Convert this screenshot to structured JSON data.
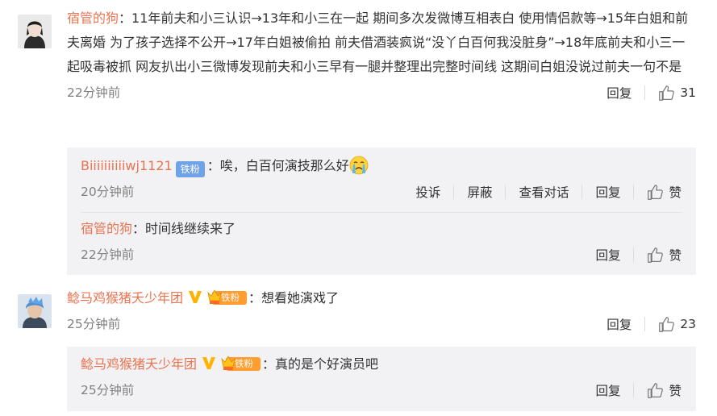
{
  "comments": [
    {
      "username": "宿管的狗",
      "text": "11年前夫和小三认识→13年和小三在一起 期间多次发微博互相表白 使用情侣款等→15年白姐和前夫离婚 为了孩子选择不公开→17年白姐被偷拍 前夫借酒装疯说“没丫白百何我没脏身”→18年底前夫和小三一起吸毒被抓 网友扒出小三微博发现前夫和小三早有一腿并整理出完整时间线 这期间白姐没说过前夫一句不是",
      "time": "22分钟前",
      "reply_label": "回复",
      "likes": "31",
      "replies": [
        {
          "username": "Biiiiiiiiiiwj1121",
          "badge": "铁粉",
          "text": "唉，白百何演技那么好",
          "emoji": "crying-face",
          "time": "20分钟前",
          "report_label": "投诉",
          "block_label": "屏蔽",
          "view_conv_label": "查看对话",
          "reply_label": "回复",
          "like_label": "赞"
        },
        {
          "username": "宿管的狗",
          "text": "时间线继续来了",
          "time": "22分钟前",
          "reply_label": "回复",
          "like_label": "赞"
        }
      ]
    },
    {
      "username": "鲶马鸡猴猪夭少年团",
      "badge": "铁粉",
      "verified": "V",
      "text": "想看她演戏了",
      "time": "25分钟前",
      "reply_label": "回复",
      "likes": "23",
      "replies": [
        {
          "username": "鲶马鸡猴猪夭少年团",
          "badge": "铁粉",
          "verified": "V",
          "text": "真的是个好演员吧",
          "time": "25分钟前",
          "reply_label": "回复",
          "like_label": "赞"
        }
      ]
    }
  ],
  "colors": {
    "username": "#eb7350",
    "time": "#808080",
    "reply_bg": "#f2f2f5",
    "fan_badge": "#6fa3e8",
    "crown_badge": "#ff9d2e"
  }
}
